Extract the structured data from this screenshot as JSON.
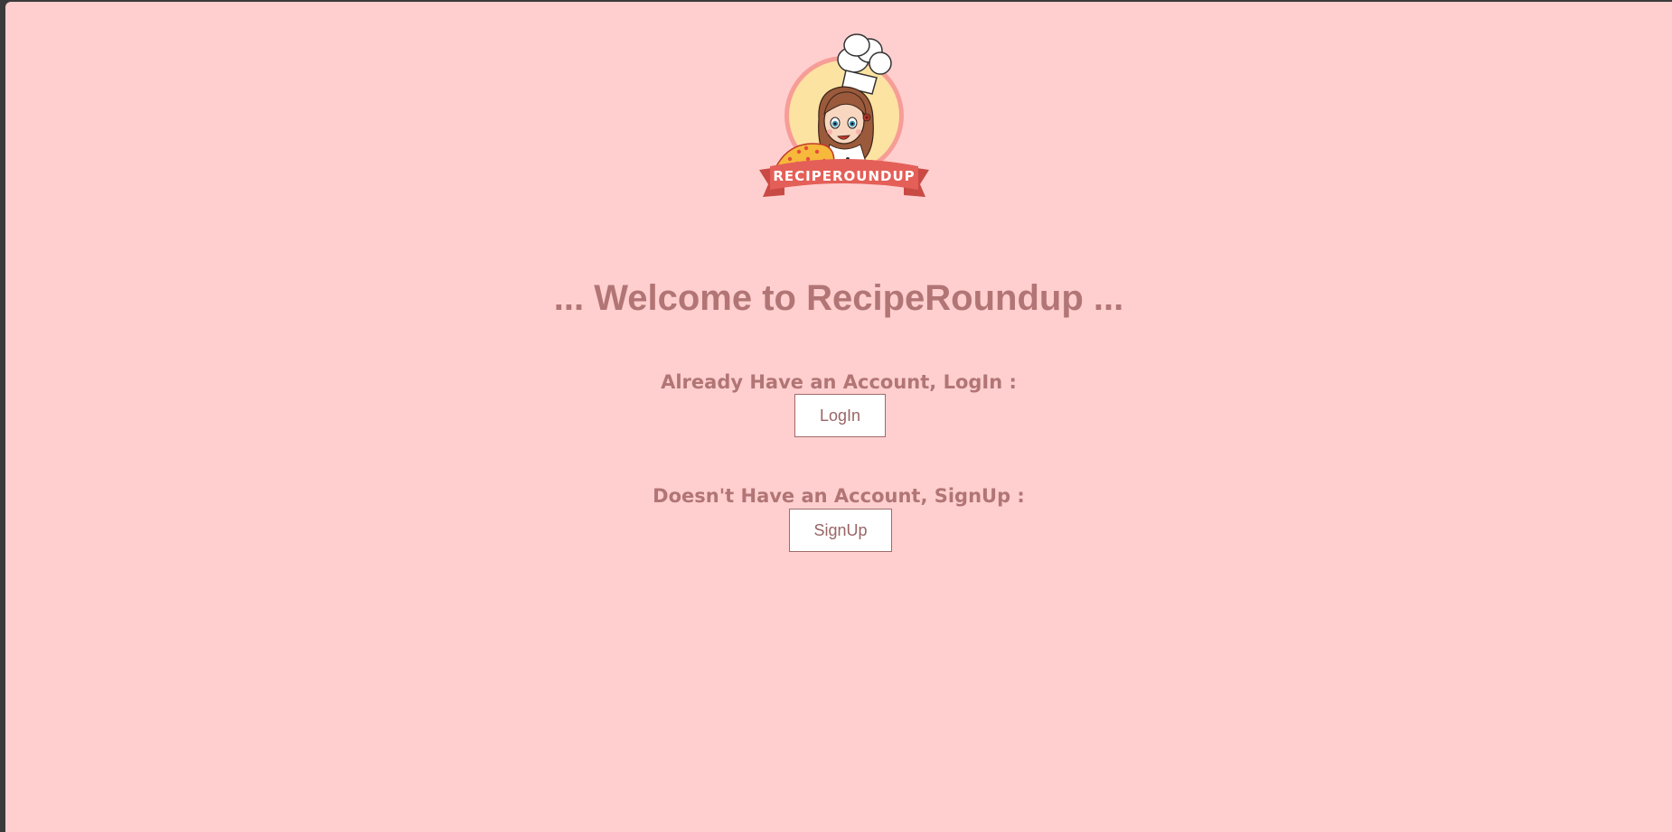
{
  "logo": {
    "banner_text": "RECIPEROUNDUP"
  },
  "heading": "... Welcome to RecipeRoundup ...",
  "login": {
    "prompt": "Already Have an Account, LogIn :",
    "button_label": "LogIn"
  },
  "signup": {
    "prompt": "Doesn't Have an Account, SignUp :",
    "button_label": "SignUp"
  },
  "colors": {
    "background": "#ffcfcf",
    "text": "#b27575",
    "banner": "#e45f58"
  }
}
